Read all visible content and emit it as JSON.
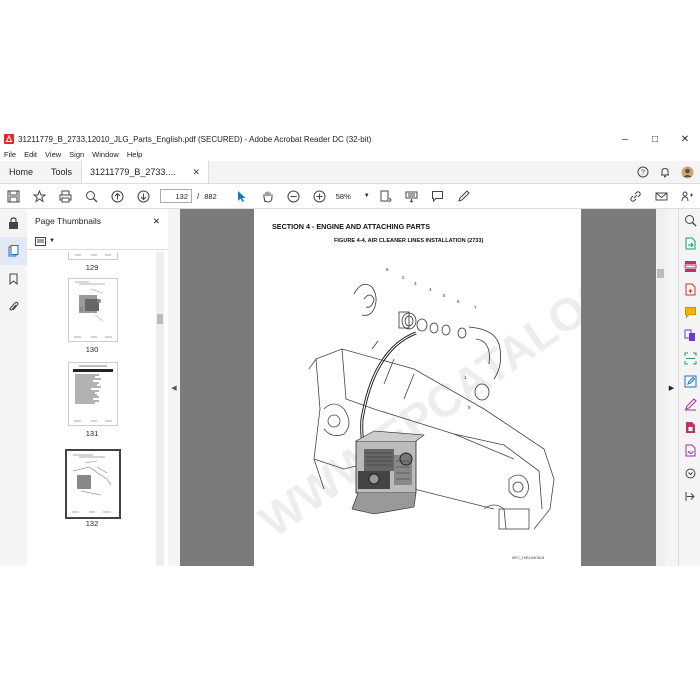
{
  "window": {
    "title": "31211779_B_2733,12010_JLG_Parts_English.pdf (SECURED) - Adobe Acrobat Reader DC (32-bit)",
    "minimize": "–",
    "maximize": "□",
    "close": "✕"
  },
  "menu": [
    "File",
    "Edit",
    "View",
    "Sign",
    "Window",
    "Help"
  ],
  "tabs": {
    "home": "Home",
    "tools": "Tools",
    "document": "31211779_B_2733....",
    "close": "✕"
  },
  "toolbar": {
    "current_page": "132",
    "separator": "/",
    "total_pages": "882",
    "zoom": "58%"
  },
  "thumbnails": {
    "title": "Page Thumbnails",
    "close": "✕",
    "pages": [
      "129",
      "130",
      "131",
      "132"
    ]
  },
  "page": {
    "section_title": "SECTION 4 - ENGINE AND ATTACHING PARTS",
    "figure_title": "FIGURE 4-4. AIR CLEANER LINES INSTALLATION (2733)",
    "watermark": "WWW.EPCATALOGS.COM",
    "footer_code": "MFC_1SB11MD8LB",
    "callouts": [
      "8",
      "2",
      "3",
      "4",
      "5",
      "6",
      "7",
      "1",
      "9"
    ]
  },
  "colors": {
    "accent": "#1a73c8",
    "red": "#d93025",
    "doc_bg": "#7b7b7b"
  },
  "icons": [
    "pdf-icon",
    "help-icon",
    "bell-icon",
    "avatar-icon",
    "save-icon",
    "star-icon",
    "print-icon",
    "search-icon",
    "arrow-up-icon",
    "arrow-down-icon",
    "cursor-icon",
    "hand-icon",
    "zoom-out-icon",
    "zoom-in-icon",
    "fit-icon",
    "keyboard-icon",
    "comment-icon",
    "sign-icon",
    "share-icon",
    "email-icon",
    "link-icon"
  ]
}
